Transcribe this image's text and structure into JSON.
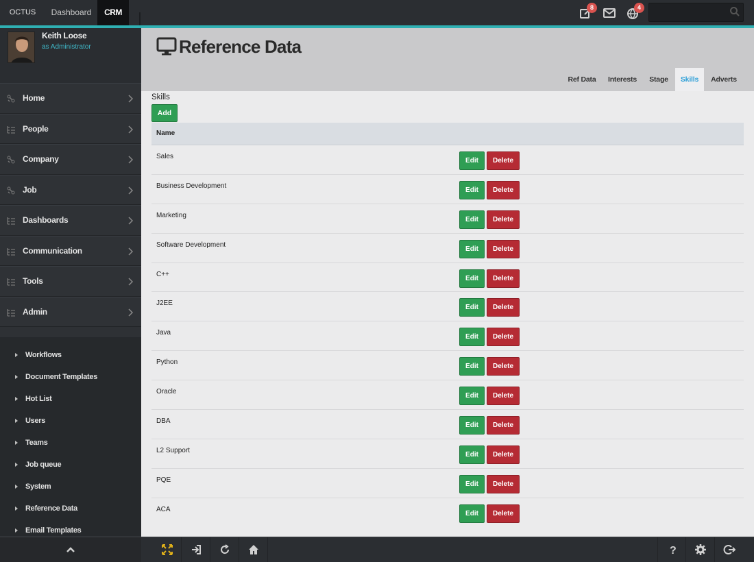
{
  "topbar": {
    "brand": "OCTUS",
    "tabs": [
      "Dashboard",
      "CRM"
    ],
    "notifications": {
      "edit_badge": "8",
      "globe_badge": "4"
    },
    "search_placeholder": ""
  },
  "user": {
    "name": "Keith Loose",
    "role": "as Administrator"
  },
  "sidebar": {
    "items": [
      {
        "label": "Home",
        "icon": "link-icon"
      },
      {
        "label": "People",
        "icon": "tree-icon"
      },
      {
        "label": "Company",
        "icon": "link-icon"
      },
      {
        "label": "Job",
        "icon": "link-icon"
      },
      {
        "label": "Dashboards",
        "icon": "tree-icon"
      },
      {
        "label": "Communication",
        "icon": "tree-icon"
      },
      {
        "label": "Tools",
        "icon": "tree-icon"
      },
      {
        "label": "Admin",
        "icon": "tree-icon"
      }
    ],
    "subitems": [
      "Workflows",
      "Document Templates",
      "Hot List",
      "Users",
      "Teams",
      "Job queue",
      "System",
      "Reference Data",
      "Email Templates"
    ]
  },
  "page": {
    "title": "Reference Data",
    "tabs": [
      "Ref Data",
      "Interests",
      "Stage",
      "Skills",
      "Adverts"
    ],
    "active_tab": "Skills"
  },
  "skills": {
    "section_label": "Skills",
    "add_label": "Add",
    "column_name": "Name",
    "edit_label": "Edit",
    "delete_label": "Delete",
    "rows": [
      "Sales",
      "Business Development",
      "Marketing",
      "Software Development",
      "C++",
      "J2EE",
      "Java",
      "Python",
      "Oracle",
      "DBA",
      "L2 Support",
      "PQE",
      "ACA"
    ]
  },
  "colors": {
    "accent": "#2fb0b3",
    "edit": "#2f9e54",
    "delete": "#b52b34",
    "active_tab": "#2fa0d8"
  }
}
